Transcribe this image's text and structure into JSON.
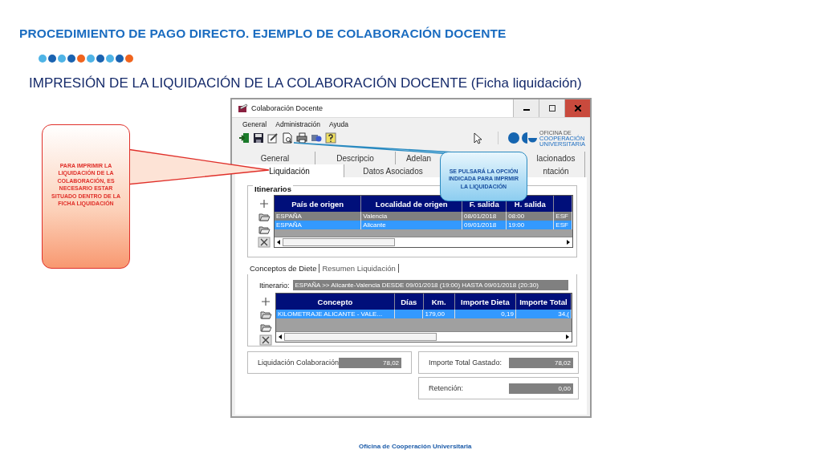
{
  "slide": {
    "title": "PROCEDIMIENTO DE PAGO DIRECTO. EJEMPLO DE COLABORACIÓN DOCENTE",
    "dots": [
      {
        "color": "#4fb4e6"
      },
      {
        "color": "#1a62b0"
      },
      {
        "color": "#4fb4e6"
      },
      {
        "color": "#1a62b0"
      },
      {
        "color": "#f0641e"
      },
      {
        "color": "#4fb4e6"
      },
      {
        "color": "#1a62b0"
      },
      {
        "color": "#4fb4e6"
      },
      {
        "color": "#1a62b0"
      },
      {
        "color": "#f0641e"
      }
    ],
    "subtitle": "IMPRESIÓN DE LA LIQUIDACIÓN DE LA COLABORACIÓN DOCENTE (Ficha liquidación)",
    "footer": "Oficina de Cooperación Universitaria"
  },
  "callouts": [
    {
      "kind": "warning",
      "text": "PARA IMPRIMIR LA LIQUIDACIÓN DE LA COLABORACIÓN, ES NECESARIO ESTAR SITUADO DENTRO DE LA FICHA LIQUIDACIÓN"
    },
    {
      "kind": "info",
      "text": "SE PULSARÁ LA OPCIÓN INDICADA PARA IMPRMIR LA LIQUIDACIÓN"
    }
  ],
  "window": {
    "title": "Colaboración Docente",
    "menu": [
      "General",
      "Administración",
      "Ayuda"
    ],
    "logo": [
      "OFICINA DE",
      "COOPERACIÓN",
      "UNIVERSITARIA"
    ],
    "tabs_top": [
      {
        "label": "General",
        "selected": false
      },
      {
        "label": "Descripcio",
        "selected": false
      },
      {
        "label": "Adelan",
        "selected": false
      },
      {
        "label": "lacionados",
        "selected": false
      }
    ],
    "tabs_bottom": [
      {
        "label": "Liquidación",
        "selected": true
      },
      {
        "label": "Datos Asociados",
        "selected": false
      },
      {
        "label": "ntación",
        "selected": false
      }
    ],
    "itinerarios": {
      "label": "Itinerarios",
      "columns": [
        "País de origen",
        "Localidad de origen",
        "F. salida",
        "H. salida"
      ],
      "rows": [
        {
          "cells": [
            "ESPAÑA",
            "Valencia",
            "08/01/2018",
            "08:00",
            "ESF"
          ],
          "selected": false
        },
        {
          "cells": [
            "ESPAÑA",
            "Alicante",
            "09/01/2018",
            "19:00",
            "ESF"
          ],
          "selected": true
        }
      ]
    },
    "subtabs": [
      {
        "label": "Conceptos de Diete",
        "selected": true
      },
      {
        "label": "Resumen Liquidación",
        "selected": false
      }
    ],
    "itinerario": {
      "label": "Itinerario:",
      "value": "ESPAÑA >> Alicante-Valencia DESDE 09/01/2018 (19:00) HASTA 09/01/2018 (20:30)"
    },
    "conceptos": {
      "columns": [
        "Concepto",
        "Días",
        "Km.",
        "Importe Dieta",
        "Importe Total"
      ],
      "rows": [
        {
          "cells": [
            "KILOMETRAJE ALICANTE - VALE...",
            null,
            "179,00",
            "0,19",
            "34,("
          ],
          "selected": true
        }
      ]
    },
    "totals": [
      {
        "label": "Liquidación Colaboración",
        "value": "78,02"
      },
      {
        "label": "Importe Total Gastado:",
        "value": "78,02"
      },
      {
        "label": "Retención:",
        "value": "0,00"
      }
    ]
  }
}
